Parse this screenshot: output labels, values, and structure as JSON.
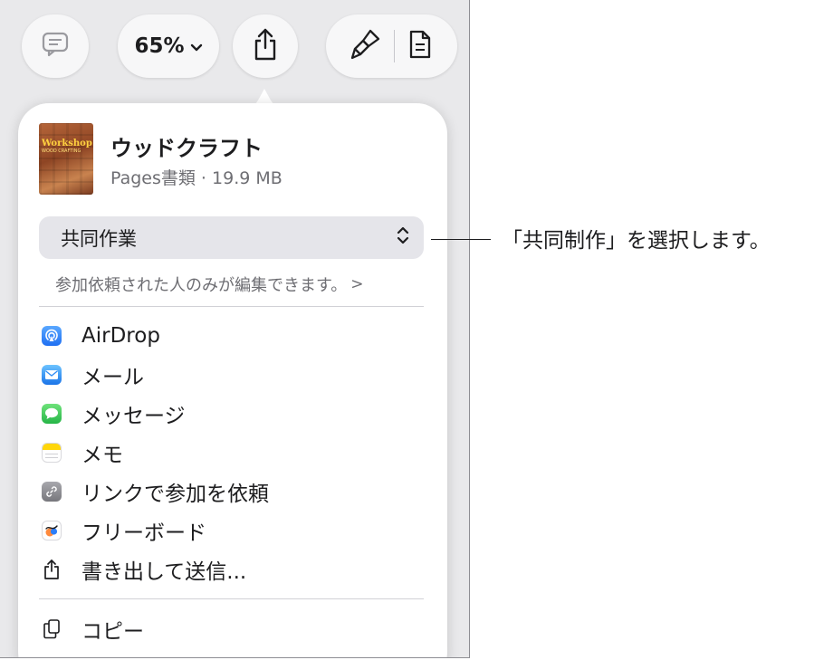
{
  "toolbar": {
    "zoom_label": "65%",
    "icons": [
      "comment-icon",
      "chevron-down-icon",
      "share-icon",
      "paintbrush-icon",
      "document-icon"
    ]
  },
  "document": {
    "title": "ウッドクラフト",
    "meta": "Pages書類 · 19.9 MB",
    "thumbnail_title": "Workshop",
    "thumbnail_subtitle": "WOOD CRAFTING"
  },
  "collaboration": {
    "selected": "共同作業",
    "note": "参加依頼された人のみが編集できます。",
    "note_chevron": ">"
  },
  "share_items": [
    {
      "label": "AirDrop",
      "icon": "airdrop-icon",
      "color": "#3c8dff"
    },
    {
      "label": "メール",
      "icon": "mail-icon",
      "color": "#2f8cf5"
    },
    {
      "label": "メッセージ",
      "icon": "messages-icon",
      "color": "#34c759"
    },
    {
      "label": "メモ",
      "icon": "notes-icon",
      "color": "#ffd60a"
    },
    {
      "label": "リンクで参加を依頼",
      "icon": "link-icon",
      "color": "#8e8e93"
    },
    {
      "label": "フリーボード",
      "icon": "freeform-icon",
      "color": "#ff7a45"
    },
    {
      "label": "書き出して送信...",
      "icon": "export-icon",
      "color": "#1d1d1f"
    }
  ],
  "actions": [
    {
      "label": "コピー",
      "icon": "copy-icon"
    }
  ],
  "callout": {
    "text": "「共同制作」を選択します。"
  },
  "colors": {
    "background": "#e9e9eb",
    "popover": "#ffffff",
    "control": "#e5e5ea",
    "secondary_text": "#6e6e73"
  }
}
